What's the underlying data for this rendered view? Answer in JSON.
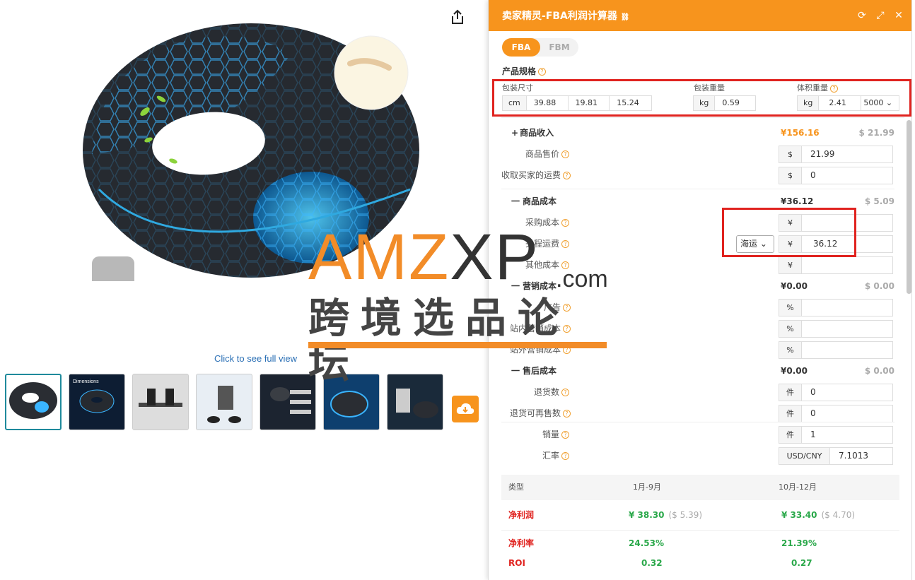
{
  "left": {
    "click_full_view": "Click to see full view",
    "thumb_label": "Dimensions"
  },
  "watermark": {
    "latin": "AMZ",
    "latin2": "XP",
    "suffix": ".com",
    "chinese": "跨境选品论坛"
  },
  "panel": {
    "title": "卖家精灵-FBA利润计算器",
    "tabs": [
      "FBA",
      "FBM"
    ],
    "spec": {
      "title": "产品规格",
      "pkg_size_label": "包装尺寸",
      "pkg_weight_label": "包装重量",
      "vol_weight_label": "体积重量",
      "size_unit": "cm",
      "dims": [
        "39.88",
        "19.81",
        "15.24"
      ],
      "weight_unit": "kg",
      "weight": "0.59",
      "vol_unit": "kg",
      "vol_weight": "2.41",
      "divisor": "5000"
    },
    "income": {
      "title": "商品收入",
      "sign": "+",
      "cny": "¥156.16",
      "usd": "$ 21.99",
      "price_label": "商品售价",
      "price_unit": "$",
      "price": "21.99",
      "shipfee_label": "收取买家的运费",
      "shipfee_unit": "$",
      "shipfee": "0"
    },
    "cost": {
      "title": "商品成本",
      "sign": "一",
      "cny": "¥36.12",
      "usd": "$ 5.09",
      "purchase_label": "采购成本",
      "purchase_unit": "¥",
      "purchase": "",
      "firstleg_label": "头程运费",
      "firstleg_mode": "海运",
      "firstleg_unit": "¥",
      "firstleg": "36.12",
      "other_label": "其他成本",
      "other_unit": "¥",
      "other": ""
    },
    "marketing": {
      "title": "营销成本",
      "sign": "一",
      "cny": "¥0.00",
      "usd": "$ 0.00",
      "ads_label": "广告",
      "ads_unit": "%",
      "onsite_label": "站内营销成本",
      "onsite_unit": "%",
      "offsite_label": "站外营销成本",
      "offsite_unit": "%"
    },
    "aftersale": {
      "title": "售后成本",
      "sign": "一",
      "cny": "¥0.00",
      "usd": "$ 0.00",
      "returns_label": "退货数",
      "returns_unit": "件",
      "returns": "0",
      "resell_label": "退货可再售数",
      "resell_unit": "件",
      "resell": "0"
    },
    "sales_label": "销量",
    "sales_unit": "件",
    "sales": "1",
    "rate_label": "汇率",
    "rate_unit": "USD/CNY",
    "rate": "7.1013",
    "results": {
      "col_type": "类型",
      "col_a": "1月-9月",
      "col_b": "10月-12月",
      "profit_label": "净利润",
      "profit_a": "¥ 38.30",
      "profit_a_usd": "($ 5.39)",
      "profit_b": "¥ 33.40",
      "profit_b_usd": "($ 4.70)",
      "margin_label": "净利率",
      "margin_a": "24.53%",
      "margin_b": "21.39%",
      "roi_label": "ROI",
      "roi_a": "0.32",
      "roi_b": "0.27"
    }
  },
  "colors": {
    "accent": "#f7941d",
    "highlight_red": "#e0231f",
    "profit_green": "#2aa84a"
  }
}
